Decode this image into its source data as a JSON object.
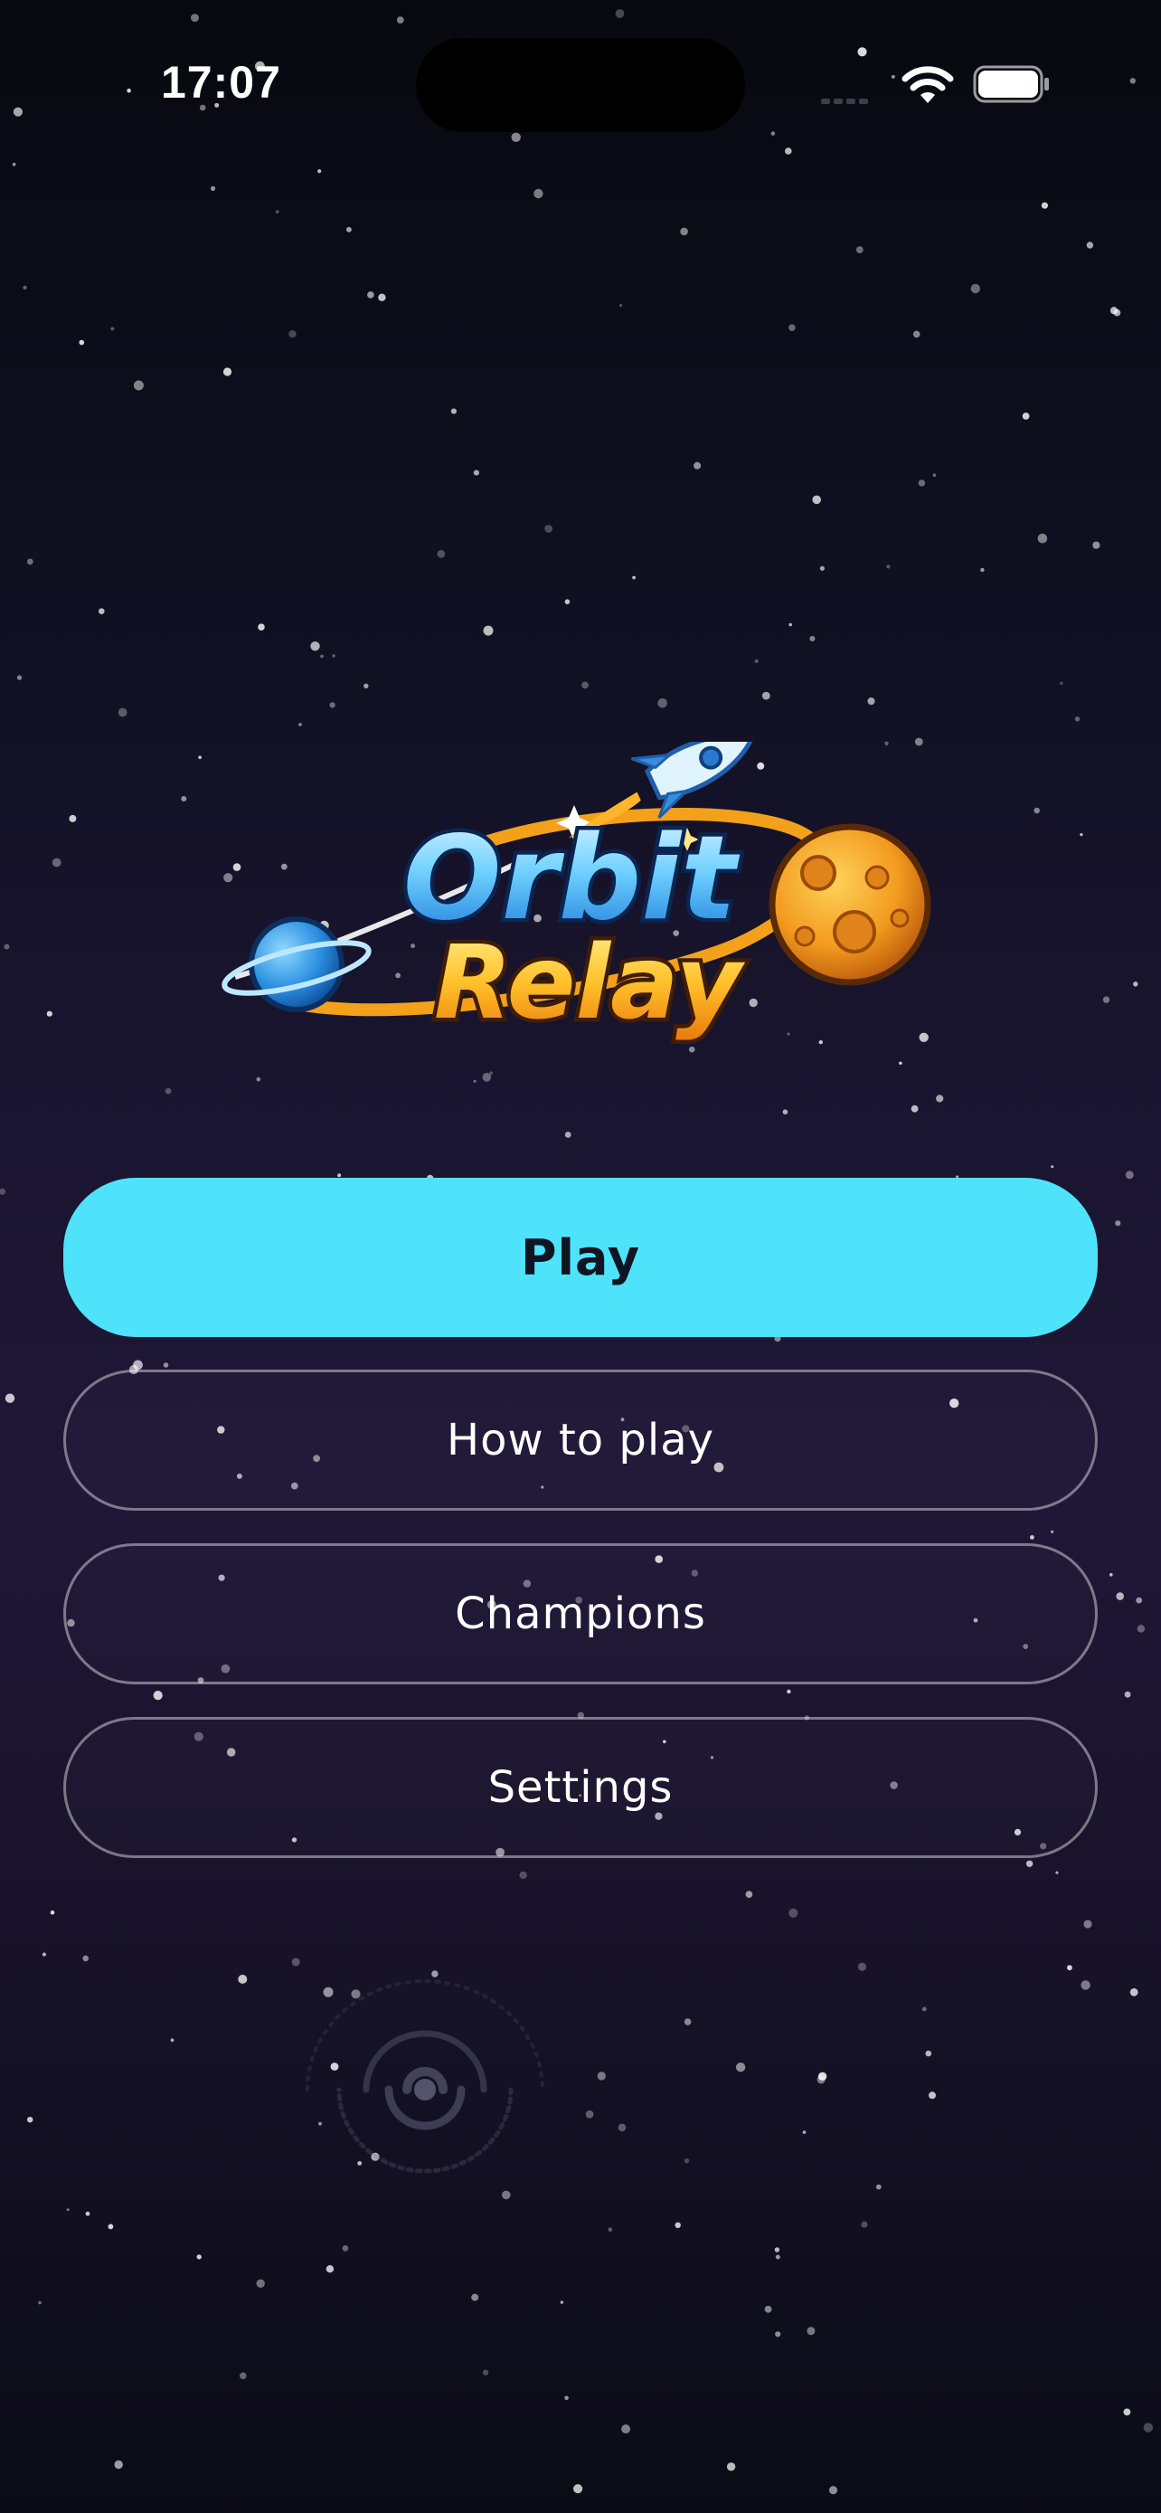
{
  "status_bar": {
    "time": "17:07"
  },
  "logo": {
    "line1": "Orbit",
    "line2": "Relay"
  },
  "menu": {
    "play_label": "Play",
    "how_to_play_label": "How to play",
    "champions_label": "Champions",
    "settings_label": "Settings"
  },
  "colors": {
    "primary_button": "#4fe3fb",
    "logo_orange": "#f5a623",
    "logo_blue": "#2aa8f0",
    "background_top": "#07090f",
    "background_mid": "#1f1736"
  },
  "icons": [
    "signal-icon",
    "wifi-icon",
    "battery-icon",
    "rocket-icon",
    "planet-icon",
    "moon-icon",
    "galaxy-icon"
  ]
}
